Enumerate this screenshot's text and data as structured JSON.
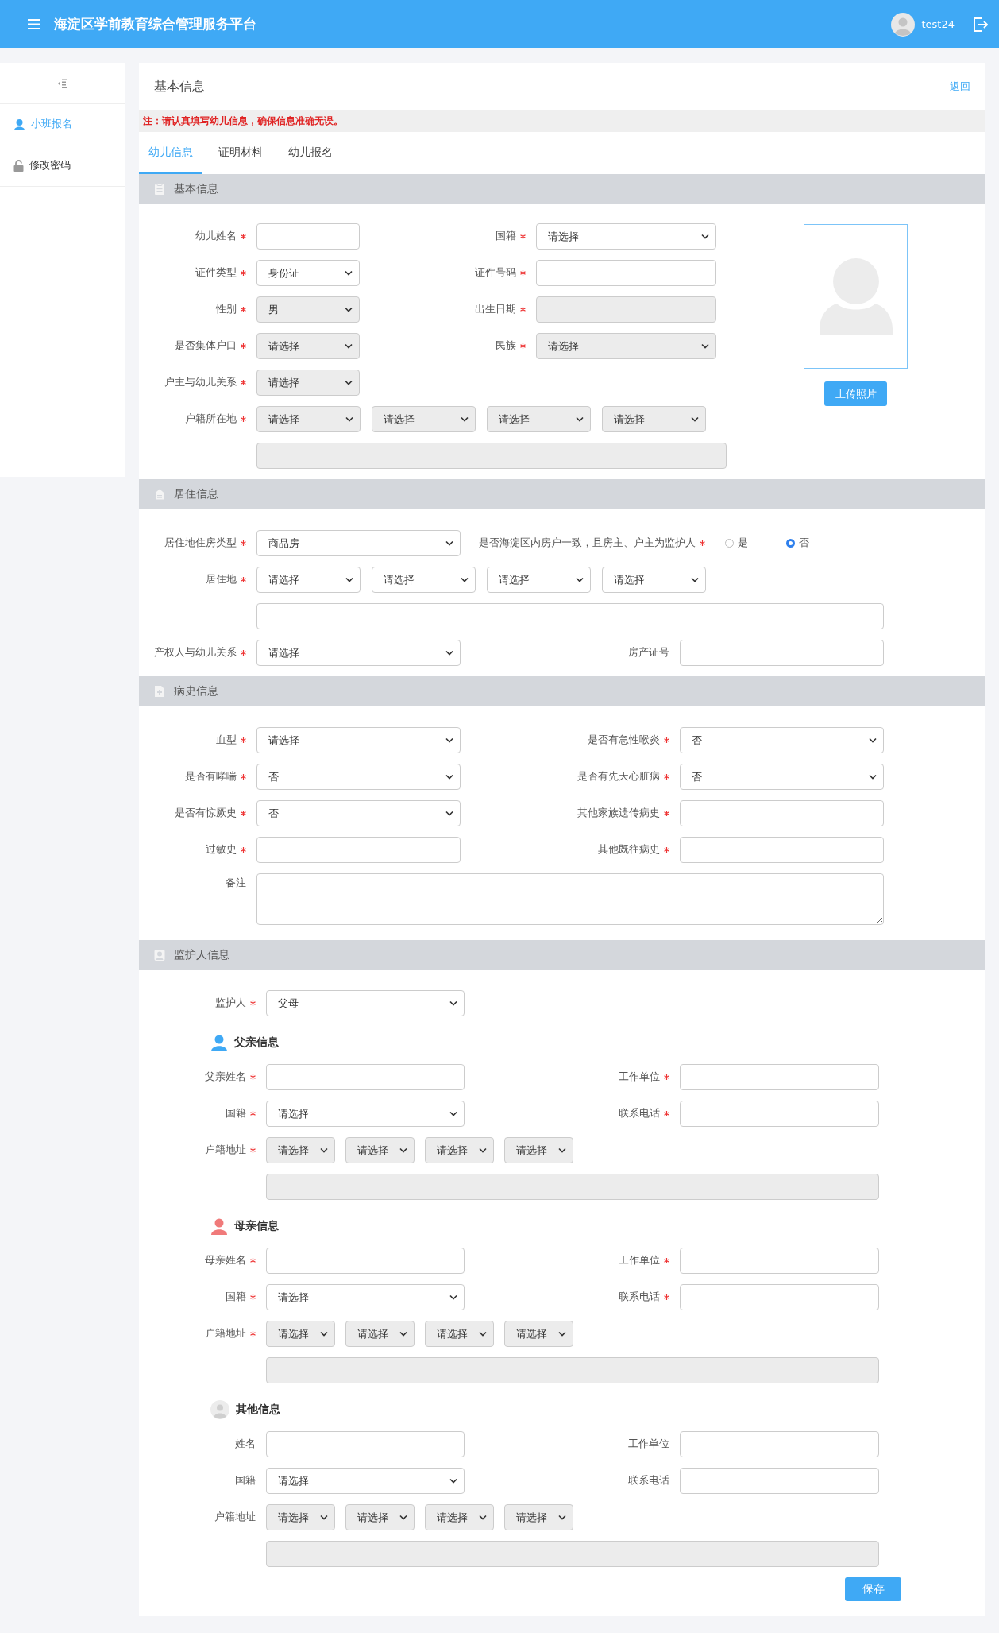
{
  "header": {
    "title": "海淀区学前教育综合管理服务平台",
    "user": "test24"
  },
  "sidebar": {
    "items": [
      {
        "label": "小班报名",
        "selected": true
      },
      {
        "label": "修改密码",
        "selected": false
      }
    ]
  },
  "page": {
    "title": "基本信息",
    "back_link": "返回",
    "notice": "注：请认真填写幼儿信息，确保信息准确无误。"
  },
  "tabs": [
    {
      "label": "幼儿信息",
      "selected": true
    },
    {
      "label": "证明材料",
      "selected": false
    },
    {
      "label": "幼儿报名",
      "selected": false
    }
  ],
  "sections": [
    {
      "kind": "basic",
      "title": "基本信息",
      "photo": {
        "button": "上传照片"
      },
      "rows": [
        {
          "kind": "fields",
          "fields": [
            {
              "label": "幼儿姓名",
              "required": true,
              "control": {
                "kind": "input",
                "disabled": false
              }
            },
            {
              "label": "国籍",
              "required": true,
              "control": {
                "kind": "select",
                "value": "请选择",
                "disabled": false
              }
            }
          ]
        },
        {
          "kind": "fields",
          "fields": [
            {
              "label": "证件类型",
              "required": true,
              "control": {
                "kind": "select",
                "value": "身份证",
                "disabled": false
              }
            },
            {
              "label": "证件号码",
              "required": true,
              "control": {
                "kind": "input",
                "disabled": false
              }
            }
          ]
        },
        {
          "kind": "fields",
          "fields": [
            {
              "label": "性别",
              "required": true,
              "control": {
                "kind": "select",
                "value": "男",
                "disabled": true
              }
            },
            {
              "label": "出生日期",
              "required": true,
              "control": {
                "kind": "input",
                "disabled": true
              }
            }
          ]
        },
        {
          "kind": "fields",
          "fields": [
            {
              "label": "是否集体户口",
              "required": true,
              "control": {
                "kind": "select",
                "value": "请选择",
                "disabled": true
              }
            },
            {
              "label": "民族",
              "required": true,
              "control": {
                "kind": "select",
                "value": "请选择",
                "disabled": true
              }
            }
          ]
        },
        {
          "kind": "fields",
          "fields": [
            {
              "label": "户主与幼儿关系",
              "required": true,
              "control": {
                "kind": "select",
                "value": "请选择",
                "disabled": true
              }
            }
          ]
        },
        {
          "kind": "fields",
          "fields": [
            {
              "label": "户籍所在地",
              "required": true,
              "control": {
                "kind": "address",
                "selects": [
                  {
                    "value": "请选择",
                    "disabled": true
                  },
                  {
                    "value": "请选择",
                    "disabled": true
                  },
                  {
                    "value": "请选择",
                    "disabled": true
                  },
                  {
                    "value": "请选择",
                    "disabled": true
                  }
                ]
              }
            }
          ]
        },
        {
          "kind": "fields",
          "fields": [
            {
              "control": {
                "kind": "input",
                "disabled": true
              }
            }
          ]
        }
      ]
    },
    {
      "kind": "residence",
      "title": "居住信息",
      "rows": [
        {
          "kind": "fields",
          "fields": [
            {
              "label": "居住地住房类型",
              "required": true,
              "control": {
                "kind": "select",
                "value": "商品房",
                "disabled": false
              }
            },
            {
              "label": "是否海淀区内房户一致，且房主、户主为监护人",
              "required": true,
              "control": {
                "kind": "radio",
                "options": [
                  {
                    "label": "是",
                    "selected": false
                  },
                  {
                    "label": "否",
                    "selected": true
                  }
                ]
              }
            }
          ]
        },
        {
          "kind": "fields",
          "fields": [
            {
              "label": "居住地",
              "required": true,
              "control": {
                "kind": "address",
                "selects": [
                  {
                    "value": "请选择",
                    "disabled": false
                  },
                  {
                    "value": "请选择",
                    "disabled": false
                  },
                  {
                    "value": "请选择",
                    "disabled": false
                  },
                  {
                    "value": "请选择",
                    "disabled": false
                  }
                ]
              }
            }
          ]
        },
        {
          "kind": "fields",
          "fields": [
            {
              "control": {
                "kind": "input",
                "disabled": false
              }
            }
          ]
        },
        {
          "kind": "fields",
          "fields": [
            {
              "label": "产权人与幼儿关系",
              "required": true,
              "control": {
                "kind": "select",
                "value": "请选择",
                "disabled": false
              }
            },
            {
              "label": "房产证号",
              "required": false,
              "control": {
                "kind": "input",
                "disabled": false
              }
            }
          ]
        }
      ]
    },
    {
      "kind": "medical",
      "title": "病史信息",
      "rows": [
        {
          "kind": "fields",
          "fields": [
            {
              "label": "血型",
              "required": true,
              "control": {
                "kind": "select",
                "value": "请选择",
                "disabled": false
              }
            },
            {
              "label": "是否有急性喉炎",
              "required": true,
              "control": {
                "kind": "select",
                "value": "否",
                "disabled": false
              }
            }
          ]
        },
        {
          "kind": "fields",
          "fields": [
            {
              "label": "是否有哮喘",
              "required": true,
              "control": {
                "kind": "select",
                "value": "否",
                "disabled": false
              }
            },
            {
              "label": "是否有先天心脏病",
              "required": true,
              "control": {
                "kind": "select",
                "value": "否",
                "disabled": false
              }
            }
          ]
        },
        {
          "kind": "fields",
          "fields": [
            {
              "label": "是否有惊厥史",
              "required": true,
              "control": {
                "kind": "select",
                "value": "否",
                "disabled": false
              }
            },
            {
              "label": "其他家族遗传病史",
              "required": true,
              "control": {
                "kind": "input",
                "disabled": false
              }
            }
          ]
        },
        {
          "kind": "fields",
          "fields": [
            {
              "label": "过敏史",
              "required": true,
              "control": {
                "kind": "input",
                "disabled": false
              }
            },
            {
              "label": "其他既往病史",
              "required": true,
              "control": {
                "kind": "input",
                "disabled": false
              }
            }
          ]
        },
        {
          "kind": "fields",
          "fields": [
            {
              "label": "备注",
              "required": false,
              "control": {
                "kind": "textarea",
                "disabled": false
              }
            }
          ]
        }
      ]
    },
    {
      "kind": "guardian",
      "title": "监护人信息",
      "rows": [
        {
          "kind": "fields",
          "fields": [
            {
              "label": "监护人",
              "required": true,
              "control": {
                "kind": "select",
                "value": "父母",
                "disabled": false
              }
            }
          ]
        },
        {
          "kind": "heading",
          "title": "父亲信息",
          "color": "#3fa9f5"
        },
        {
          "kind": "fields",
          "fields": [
            {
              "label": "父亲姓名",
              "required": true,
              "control": {
                "kind": "input",
                "disabled": false
              }
            },
            {
              "label": "工作单位",
              "required": true,
              "control": {
                "kind": "input",
                "disabled": false
              }
            }
          ]
        },
        {
          "kind": "fields",
          "fields": [
            {
              "label": "国籍",
              "required": true,
              "control": {
                "kind": "select",
                "value": "请选择",
                "disabled": false
              }
            },
            {
              "label": "联系电话",
              "required": true,
              "control": {
                "kind": "input",
                "disabled": false
              }
            }
          ]
        },
        {
          "kind": "fields",
          "fields": [
            {
              "label": "户籍地址",
              "required": true,
              "control": {
                "kind": "address",
                "selects": [
                  {
                    "value": "请选择",
                    "disabled": true
                  },
                  {
                    "value": "请选择",
                    "disabled": true
                  },
                  {
                    "value": "请选择",
                    "disabled": true
                  },
                  {
                    "value": "请选择",
                    "disabled": true
                  }
                ]
              }
            }
          ]
        },
        {
          "kind": "fields",
          "fields": [
            {
              "control": {
                "kind": "input",
                "disabled": true
              }
            }
          ]
        },
        {
          "kind": "heading",
          "title": "母亲信息",
          "color": "#f07a7a"
        },
        {
          "kind": "fields",
          "fields": [
            {
              "label": "母亲姓名",
              "required": true,
              "control": {
                "kind": "input",
                "disabled": false
              }
            },
            {
              "label": "工作单位",
              "required": true,
              "control": {
                "kind": "input",
                "disabled": false
              }
            }
          ]
        },
        {
          "kind": "fields",
          "fields": [
            {
              "label": "国籍",
              "required": true,
              "control": {
                "kind": "select",
                "value": "请选择",
                "disabled": false
              }
            },
            {
              "label": "联系电话",
              "required": true,
              "control": {
                "kind": "input",
                "disabled": false
              }
            }
          ]
        },
        {
          "kind": "fields",
          "fields": [
            {
              "label": "户籍地址",
              "required": true,
              "control": {
                "kind": "address",
                "selects": [
                  {
                    "value": "请选择",
                    "disabled": true
                  },
                  {
                    "value": "请选择",
                    "disabled": true
                  },
                  {
                    "value": "请选择",
                    "disabled": true
                  },
                  {
                    "value": "请选择",
                    "disabled": true
                  }
                ]
              }
            }
          ]
        },
        {
          "kind": "fields",
          "fields": [
            {
              "control": {
                "kind": "input",
                "disabled": true
              }
            }
          ]
        },
        {
          "kind": "avatar",
          "title": "其他信息"
        },
        {
          "kind": "fields",
          "fields": [
            {
              "label": "姓名",
              "required": false,
              "control": {
                "kind": "input",
                "disabled": false
              }
            },
            {
              "label": "工作单位",
              "required": false,
              "control": {
                "kind": "input",
                "disabled": false
              }
            }
          ]
        },
        {
          "kind": "fields",
          "fields": [
            {
              "label": "国籍",
              "required": false,
              "control": {
                "kind": "select",
                "value": "请选择",
                "disabled": false
              }
            },
            {
              "label": "联系电话",
              "required": false,
              "control": {
                "kind": "input",
                "disabled": false
              }
            }
          ]
        },
        {
          "kind": "fields",
          "fields": [
            {
              "label": "户籍地址",
              "required": false,
              "control": {
                "kind": "address",
                "selects": [
                  {
                    "value": "请选择",
                    "disabled": true
                  },
                  {
                    "value": "请选择",
                    "disabled": true
                  },
                  {
                    "value": "请选择",
                    "disabled": true
                  },
                  {
                    "value": "请选择",
                    "disabled": true
                  }
                ]
              }
            }
          ]
        },
        {
          "kind": "fields",
          "fields": [
            {
              "control": {
                "kind": "input",
                "disabled": true
              }
            }
          ]
        }
      ]
    }
  ],
  "save_button": "保存"
}
